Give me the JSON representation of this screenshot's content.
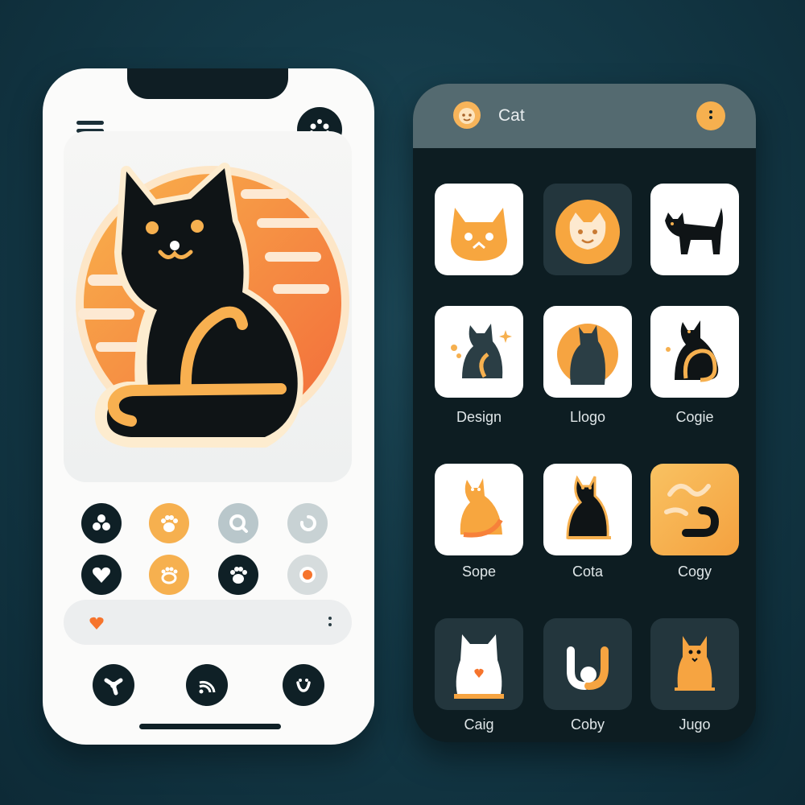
{
  "colors": {
    "background": "#143a48",
    "accent_orange": "#f6a441",
    "dark": "#0f2026",
    "light_surface": "#fbfbfa"
  },
  "left_phone": {
    "menu_icon": "hamburger-menu-icon",
    "profile_icon": "paw-face-icon",
    "hero_icon": "black-cat-logo",
    "icon_grid": [
      "flower-icon",
      "paw-icon",
      "search-icon",
      "refresh-icon",
      "heart-icon",
      "paw-print-icon",
      "paw-icon",
      "record-icon"
    ],
    "search": {
      "placeholder": "",
      "value": ""
    },
    "bottom_nav": [
      "share-icon",
      "wifi-icon",
      "smile-icon"
    ]
  },
  "right_phone": {
    "header": {
      "title": "Cat",
      "more_icon": "more-dots-icon"
    },
    "tiles": [
      {
        "icon": "cat-face-icon",
        "label": ""
      },
      {
        "icon": "cat-face-icon",
        "label": ""
      },
      {
        "icon": "walking-cat-icon",
        "label": ""
      },
      {
        "icon": "sitting-cat-icon",
        "label": "Design"
      },
      {
        "icon": "cat-silhouette-icon",
        "label": "Llogo"
      },
      {
        "icon": "sitting-cat-icon",
        "label": "Cogie"
      },
      {
        "icon": "orange-cat-icon",
        "label": "Sope"
      },
      {
        "icon": "black-cat-icon",
        "label": "Cota"
      },
      {
        "icon": "abstract-tail-icon",
        "label": "Cogy"
      },
      {
        "icon": "white-cat-icon",
        "label": "Caig"
      },
      {
        "icon": "ball-tail-icon",
        "label": "Coby"
      },
      {
        "icon": "orange-cat-icon",
        "label": "Jugo"
      }
    ]
  }
}
